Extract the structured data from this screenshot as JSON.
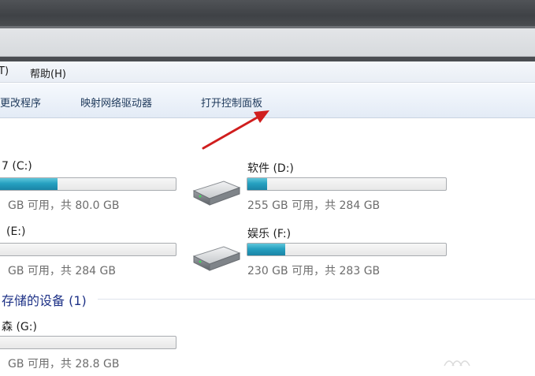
{
  "menubar": {
    "items": [
      "T)",
      "帮助(H)"
    ]
  },
  "commandbar": {
    "items": [
      "更改程序",
      "映射网络驱动器",
      "打开控制面板"
    ]
  },
  "drives": [
    {
      "label": "7 (C:)",
      "free": "GB 可用，共 80.0 GB",
      "fill_fraction": 0.33
    },
    {
      "label": "软件 (D:)",
      "free": "255 GB 可用，共 284 GB",
      "fill_fraction": 0.1
    },
    {
      "label": "(E:)",
      "free": "GB 可用，共 284 GB",
      "fill_fraction": 0.0
    },
    {
      "label": "娱乐 (F:)",
      "free": "230 GB 可用，共 283 GB",
      "fill_fraction": 0.19
    }
  ],
  "removable_section": {
    "title": "存储的设备 (1)",
    "device": {
      "label": "森 (G:)",
      "free": "GB 可用，共 28.8 GB",
      "fill_fraction": 0.0
    }
  },
  "colors": {
    "fill": "#26a0c0",
    "section_header": "#1e3287",
    "arrow": "#d01e1e"
  },
  "icons": [
    "hard-drive-icon",
    "arrow-annotation",
    "watermark-logo"
  ]
}
